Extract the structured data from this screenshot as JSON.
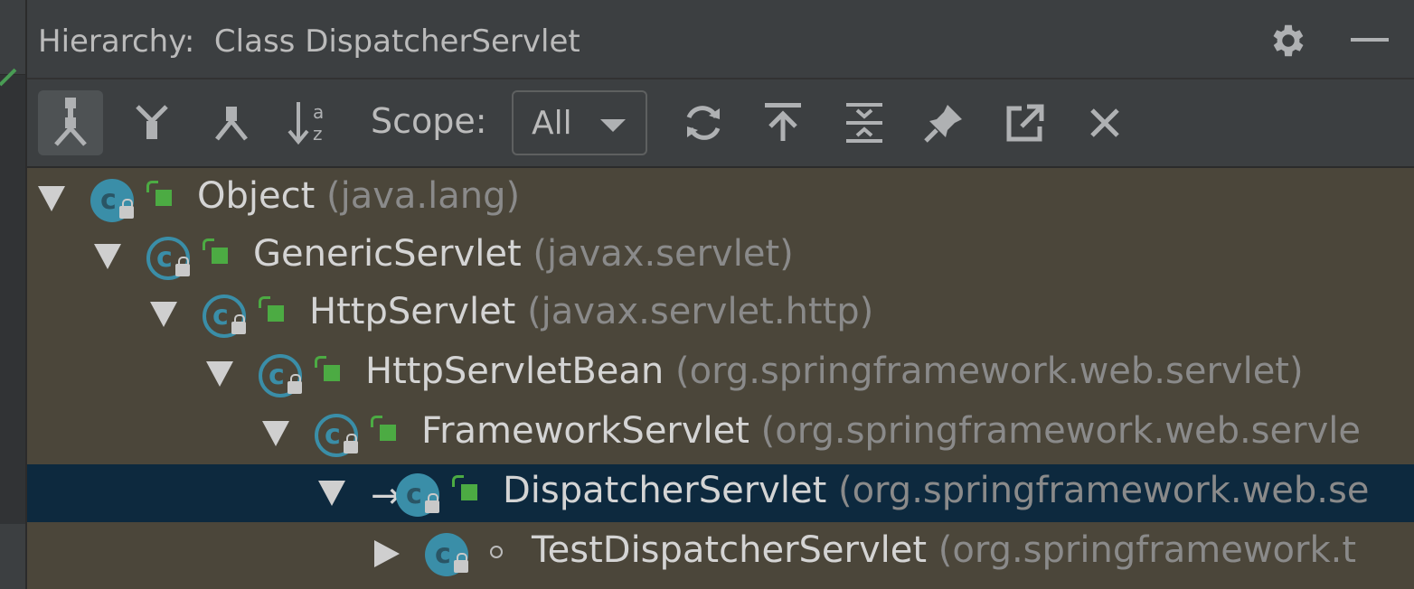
{
  "window": {
    "title": "Hierarchy:  Class DispatcherServlet"
  },
  "icons": {
    "settings": "gear-icon",
    "minimize": "minimize-icon"
  },
  "toolbar": {
    "scope_label": "Scope:",
    "scope_value": "All",
    "buttons": [
      {
        "name": "type-hierarchy",
        "icon": "class-hierarchy-icon"
      },
      {
        "name": "supertypes-hierarchy",
        "icon": "supertypes-icon"
      },
      {
        "name": "subtypes-hierarchy",
        "icon": "subtypes-icon"
      },
      {
        "name": "sort-alphabetically",
        "icon": "sort-alpha-icon"
      },
      {
        "name": "refresh",
        "icon": "refresh-icon"
      },
      {
        "name": "scroll-to-source",
        "icon": "export-up-icon"
      },
      {
        "name": "expand-all",
        "icon": "expand-all-icon"
      },
      {
        "name": "pin-tab",
        "icon": "pin-icon"
      },
      {
        "name": "open-in-editor",
        "icon": "external-link-icon"
      },
      {
        "name": "close",
        "icon": "close-icon"
      }
    ]
  },
  "tree": [
    {
      "name": "Object",
      "package": " (java.lang)",
      "expanded": true,
      "depth": 0,
      "abstract": false
    },
    {
      "name": "GenericServlet",
      "package": " (javax.servlet)",
      "expanded": true,
      "depth": 1,
      "abstract": true
    },
    {
      "name": "HttpServlet",
      "package": " (javax.servlet.http)",
      "expanded": true,
      "depth": 2,
      "abstract": true
    },
    {
      "name": "HttpServletBean",
      "package": " (org.springframework.web.servlet)",
      "expanded": true,
      "depth": 3,
      "abstract": true
    },
    {
      "name": "FrameworkServlet",
      "package": " (org.springframework.web.servle",
      "expanded": true,
      "depth": 4,
      "abstract": true
    },
    {
      "name": "DispatcherServlet",
      "package": " (org.springframework.web.se",
      "expanded": true,
      "depth": 5,
      "abstract": false,
      "selected": true,
      "current": true
    },
    {
      "name": "TestDispatcherServlet",
      "package": " (org.springframework.t",
      "expanded": false,
      "depth": 6,
      "abstract": false
    }
  ],
  "colors": {
    "panel_bg": "#3c3f41",
    "tree_bg": "#4b463a",
    "selection": "#0d293e",
    "class_icon": "#3a8ea8",
    "public_green": "#4cab43"
  }
}
